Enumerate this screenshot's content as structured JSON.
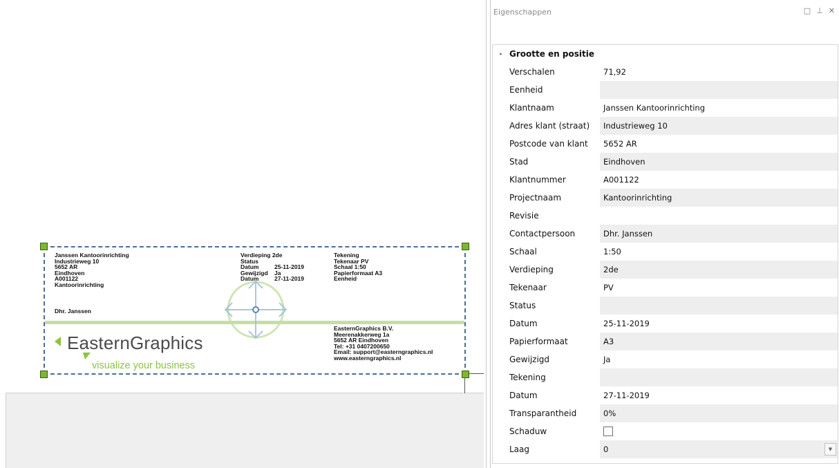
{
  "panel": {
    "title": "Eigenschappen",
    "buttons": {
      "maximize": "□",
      "pin": "⊥",
      "close": "✕"
    },
    "group": {
      "label": "Grootte en positie",
      "expander": "▸"
    },
    "rows": [
      {
        "name": "Verschalen",
        "value": "71,92",
        "shaded": false
      },
      {
        "name": "Eenheid",
        "value": "",
        "shaded": true
      },
      {
        "name": "Klantnaam",
        "value": "Janssen Kantoorinrichting",
        "shaded": false
      },
      {
        "name": "Adres klant (straat)",
        "value": "Industrieweg 10",
        "shaded": true
      },
      {
        "name": "Postcode van klant",
        "value": "5652 AR",
        "shaded": false
      },
      {
        "name": "Stad",
        "value": "Eindhoven",
        "shaded": true
      },
      {
        "name": "Klantnummer",
        "value": "A001122",
        "shaded": false
      },
      {
        "name": "Projectnaam",
        "value": "Kantoorinrichting",
        "shaded": true
      },
      {
        "name": "Revisie",
        "value": "",
        "shaded": false
      },
      {
        "name": "Contactpersoon",
        "value": "Dhr. Janssen",
        "shaded": true
      },
      {
        "name": "Schaal",
        "value": "1:50",
        "shaded": false
      },
      {
        "name": "Verdieping",
        "value": "2de",
        "shaded": true
      },
      {
        "name": "Tekenaar",
        "value": "PV",
        "shaded": false
      },
      {
        "name": "Status",
        "value": "",
        "shaded": true
      },
      {
        "name": "Datum",
        "value": "25-11-2019",
        "shaded": false
      },
      {
        "name": "Papierformaat",
        "value": "A3",
        "shaded": true
      },
      {
        "name": "Gewijzigd",
        "value": "Ja",
        "shaded": false
      },
      {
        "name": "Tekening",
        "value": "",
        "shaded": true
      },
      {
        "name": "Datum",
        "value": "27-11-2019",
        "shaded": false
      },
      {
        "name": "Transparantheid",
        "value": "0%",
        "shaded": true
      },
      {
        "name": "Schaduw",
        "value": "",
        "control": "checkbox",
        "checked": false,
        "shaded": false
      },
      {
        "name": "Laag",
        "value": "0",
        "control": "dropdown",
        "shaded": true
      }
    ],
    "dropdown_icon": "▼"
  },
  "titleblock": {
    "client_lines": [
      "Janssen Kantoorinrichting",
      "Industrieweg 10",
      "5652 AR",
      "Eindhoven",
      "A001122",
      "Kantoorinrichting"
    ],
    "contact": "Dhr. Janssen",
    "middle_labels": [
      "Verdieping 2de",
      "Status",
      "Datum",
      "Gewijzigd",
      "Datum"
    ],
    "middle_values": [
      "",
      "",
      "25-11-2019",
      "Ja",
      "27-11-2019"
    ],
    "right_lines": [
      "Tekening",
      "Tekenaar PV",
      "Schaal    1:50",
      "Papierformaat A3",
      "Eenheid"
    ],
    "company_lines": [
      "EasternGraphics B.V.",
      "Meerenakkerweg 1a",
      "5652 AR Eindhoven",
      "Tel: +31 0407200650",
      "Email: support@easterngraphics.nl",
      "www.easterngraphics.nl"
    ],
    "logo_name": "EasternGraphics",
    "logo_tagline": "visualize your business"
  },
  "colors": {
    "handle": "#7cb82f",
    "selection_border": "#4a6d96",
    "logo_green": "#8cc43c",
    "gizmo_blue": "#4f87c6"
  }
}
